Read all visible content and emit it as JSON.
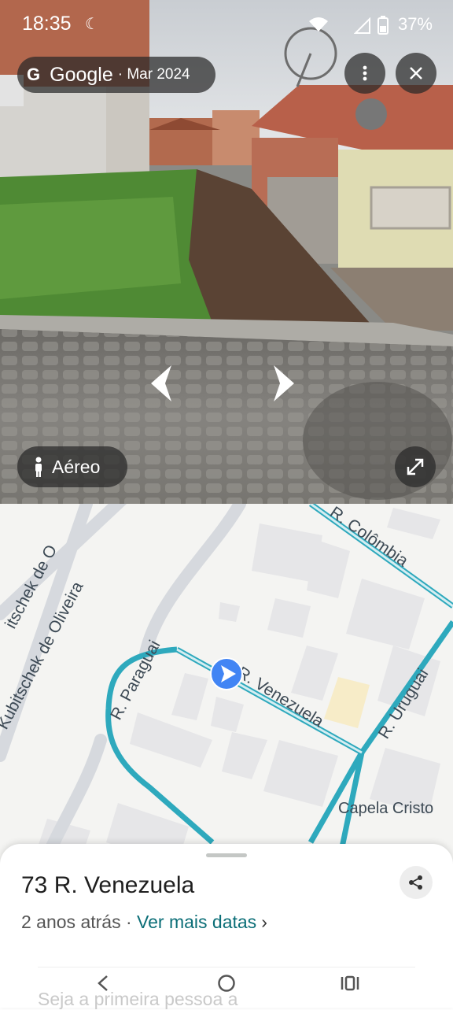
{
  "status_bar": {
    "time": "18:35",
    "battery": "37%"
  },
  "street_view": {
    "provider": "Google",
    "capture_date": "· Mar 2024",
    "aerial_label": "Aéreo"
  },
  "map": {
    "streets": {
      "colombia": "R. Colômbia",
      "kubitschek_1": "itschek de O",
      "kubitschek_2": "Kubitschek de Oliveira",
      "paraguai": "R. Paraguai",
      "venezuela": "R. Venezuela",
      "uruguai": "R. Uruguai"
    },
    "poi": "Capela Cristo"
  },
  "sheet": {
    "address": "73 R. Venezuela",
    "age": "2 anos atrás",
    "separator": " · ",
    "more_dates": "Ver mais datas",
    "more_chevron": "›",
    "partial_text": "Seja a primeira pessoa a"
  },
  "colors": {
    "road_teal": "#2ea9bd",
    "accent_link": "#0b6e77",
    "pin_blue": "#4285f4"
  },
  "icons": [
    "moon-icon",
    "wifi-icon",
    "signal-icon",
    "battery-icon",
    "google-g-icon",
    "more-vert-icon",
    "close-icon",
    "arrow-left-icon",
    "arrow-right-icon",
    "person-icon",
    "expand-icon",
    "location-pin-icon",
    "share-icon",
    "back-icon",
    "home-icon",
    "recents-icon"
  ]
}
